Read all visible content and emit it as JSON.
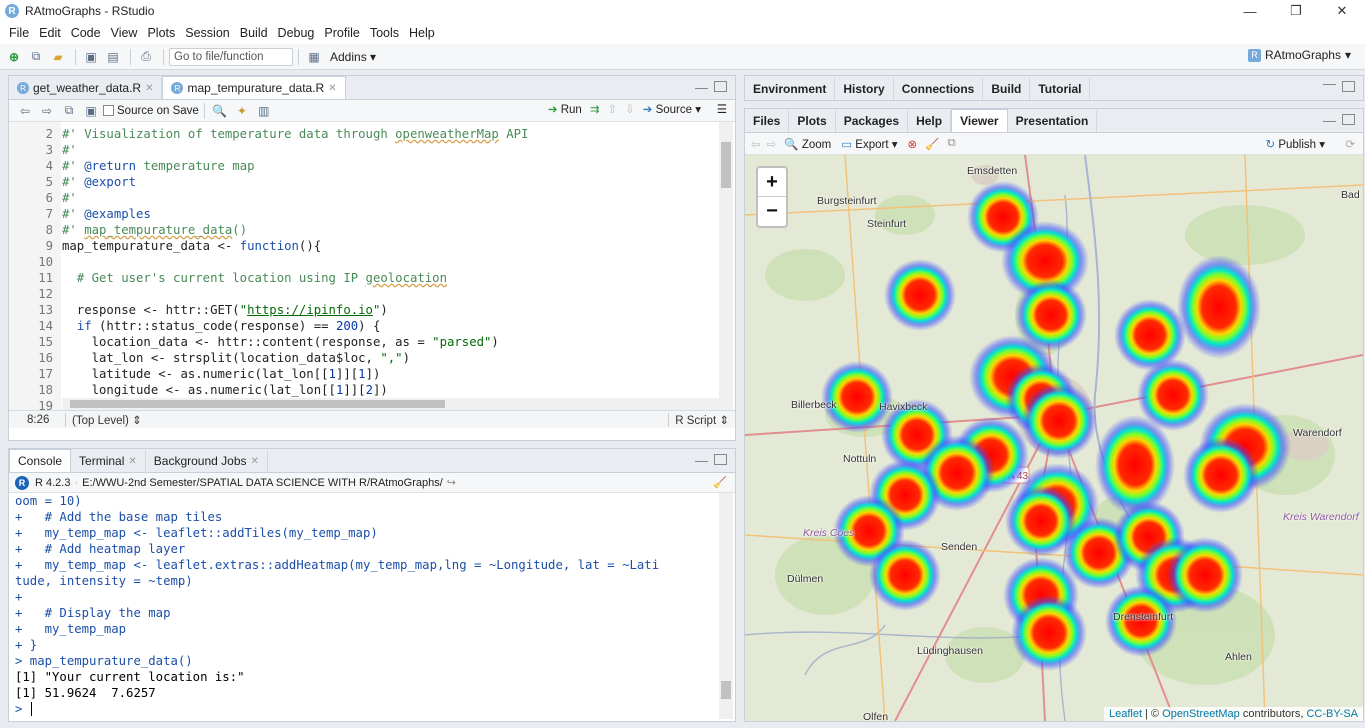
{
  "window": {
    "title": "RAtmoGraphs - RStudio"
  },
  "menu": [
    "File",
    "Edit",
    "Code",
    "View",
    "Plots",
    "Session",
    "Build",
    "Debug",
    "Profile",
    "Tools",
    "Help"
  ],
  "toolbar": {
    "goto_placeholder": "Go to file/function",
    "addins": "Addins",
    "project": "RAtmoGraphs"
  },
  "source": {
    "tabs": [
      "get_weather_data.R",
      "map_tempurature_data.R"
    ],
    "source_on_save": "Source on Save",
    "run": "Run",
    "source_btn": "Source",
    "line_numbers": [
      "2",
      "3",
      "4",
      "5",
      "6",
      "7",
      "8",
      "9",
      "10",
      "11",
      "12",
      "13",
      "14",
      "15",
      "16",
      "17",
      "18",
      "19"
    ],
    "position": "8:26",
    "scope": "(Top Level)",
    "filetype": "R Script"
  },
  "console": {
    "tabs": [
      "Console",
      "Terminal",
      "Background Jobs"
    ],
    "r_version": "R 4.2.3",
    "path": "E:/WWU-2nd Semester/SPATIAL DATA SCIENCE WITH R/RAtmoGraphs/",
    "lines": [
      "oom = 10)",
      "+   # Add the base map tiles",
      "+   my_temp_map <- leaflet::addTiles(my_temp_map)",
      "+   # Add heatmap layer",
      "+   my_temp_map <- leaflet.extras::addHeatmap(my_temp_map,lng = ~Longitude, lat = ~Lati",
      "tude, intensity = ~temp)",
      "+",
      "+   # Display the map",
      "+   my_temp_map",
      "+ }",
      "> map_tempurature_data()",
      "[1] \"Your current location is:\"",
      "[1] 51.9624  7.6257",
      ">"
    ]
  },
  "env": {
    "tabs": [
      "Environment",
      "History",
      "Connections",
      "Build",
      "Tutorial"
    ]
  },
  "viewer": {
    "tabs": [
      "Files",
      "Plots",
      "Packages",
      "Help",
      "Viewer",
      "Presentation"
    ],
    "zoom": "Zoom",
    "export": "Export",
    "publish": "Publish",
    "zoom_in": "+",
    "zoom_out": "−",
    "attribution_leaflet": "Leaflet",
    "attribution_sep": " | © ",
    "attribution_osm": "OpenStreetMap",
    "attribution_contrib": " contributors, ",
    "attribution_license": "CC-BY-SA",
    "places": [
      "Emsdetten",
      "Burgsteinfurt",
      "Steinfurt",
      "Billerbeck",
      "Havixbeck",
      "Nottuln",
      "Senden",
      "Dülmen",
      "Lüdinghausen",
      "Warendorf",
      "Kreis Warendorf",
      "Ahlen",
      "Bad",
      "A 43",
      "Olfen",
      "Kreis Coes",
      "Drensteinfurt"
    ]
  },
  "colors": {
    "accent": "#75aadb",
    "comment": "#4a8a58",
    "keyword": "#1c4fa8"
  }
}
